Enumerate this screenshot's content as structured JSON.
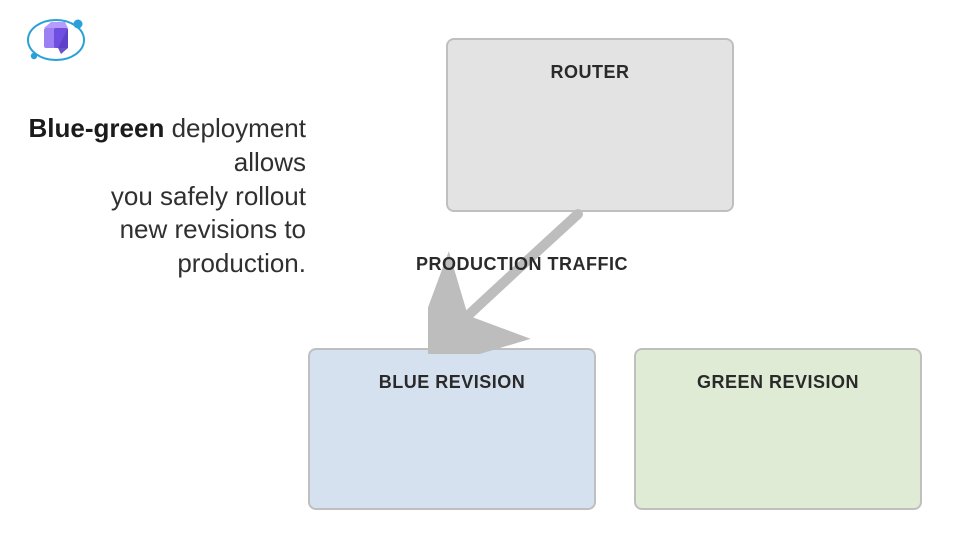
{
  "description": {
    "strong": "Blue-green",
    "rest_line1": " deployment allows",
    "line2": "you safely rollout",
    "line3": "new revisions to",
    "line4": "production."
  },
  "boxes": {
    "router": "ROUTER",
    "blue": "BLUE REVISION",
    "green": "GREEN REVISION"
  },
  "arrow_label": "PRODUCTION TRAFFIC",
  "colors": {
    "router_fill": "#e3e3e3",
    "blue_fill": "#d6e1f0",
    "green_fill": "#dfebd4",
    "border": "#bfbfbf",
    "arrow": "#bdbdbd",
    "icon_primary": "#7b61ff",
    "icon_accent": "#2aa0d8"
  }
}
